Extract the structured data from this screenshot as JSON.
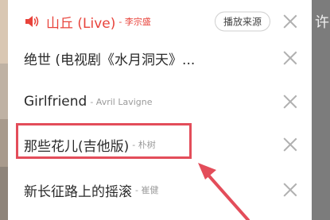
{
  "playlist": {
    "now_playing": {
      "title": "山丘 (Live)",
      "artist": "- 李宗盛",
      "source_button": "播放来源"
    },
    "items": [
      {
        "title": "绝世 (电视剧《水月洞天》...",
        "artist": ""
      },
      {
        "title": "Girlfriend",
        "artist": "- Avril Lavigne"
      },
      {
        "title": "那些花儿(吉他版)",
        "artist": "- 朴树"
      },
      {
        "title": "新长征路上的摇滚",
        "artist": "- 崔健"
      }
    ]
  },
  "background": {
    "right_glyph": "许"
  },
  "colors": {
    "accent": "#e8433b",
    "highlight": "#e34d5a"
  },
  "icons": {
    "now_playing": "speaker-icon",
    "remove": "close-icon"
  }
}
